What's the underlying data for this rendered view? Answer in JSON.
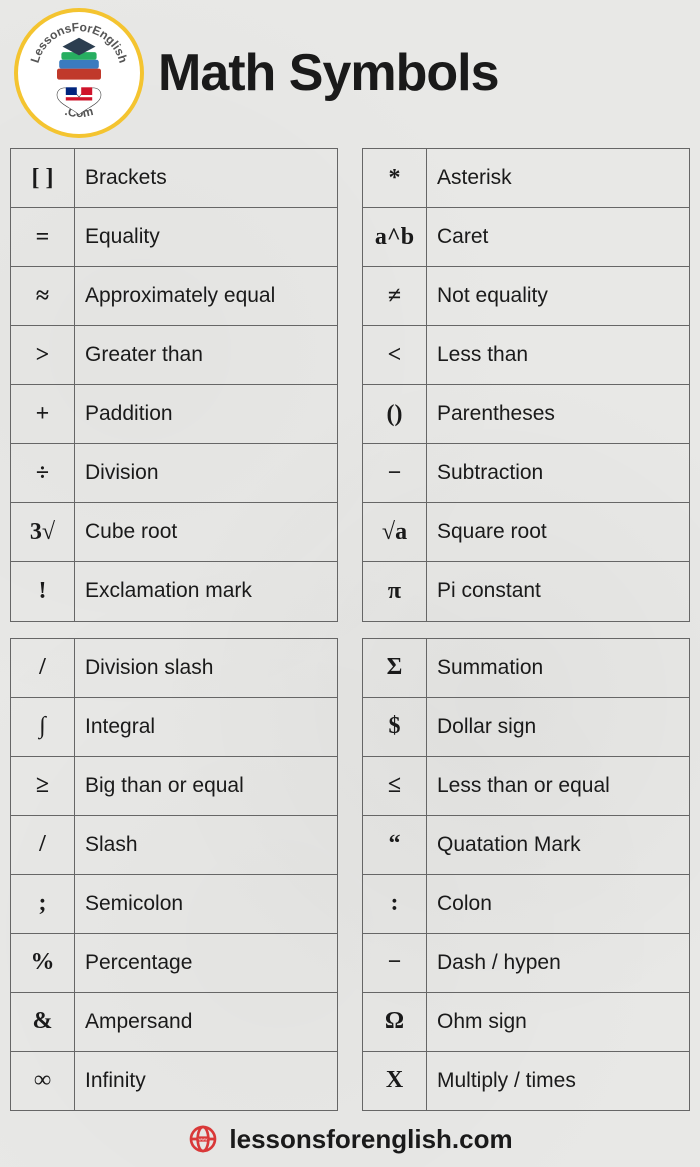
{
  "title": "Math Symbols",
  "logo_text": "LessonsForEnglish.Com",
  "footer": "lessonsforenglish.com",
  "tables": [
    [
      {
        "sym": "[ ]",
        "name": "Brackets"
      },
      {
        "sym": "=",
        "name": "Equality"
      },
      {
        "sym": "≈",
        "name": "Approximately equal"
      },
      {
        "sym": ">",
        "name": "Greater than"
      },
      {
        "sym": "+",
        "name": "Paddition"
      },
      {
        "sym": "÷",
        "name": "Division"
      },
      {
        "sym": "3√",
        "name": "Cube root"
      },
      {
        "sym": "!",
        "name": "Exclamation mark"
      }
    ],
    [
      {
        "sym": "*",
        "name": "Asterisk"
      },
      {
        "sym": "a^b",
        "name": "Caret"
      },
      {
        "sym": "≠",
        "name": "Not equality"
      },
      {
        "sym": "<",
        "name": "Less than"
      },
      {
        "sym": "()",
        "name": "Parentheses"
      },
      {
        "sym": "−",
        "name": "Subtraction"
      },
      {
        "sym": "√a",
        "name": "Square root"
      },
      {
        "sym": "π",
        "name": "Pi constant"
      }
    ],
    [
      {
        "sym": "/",
        "name": "Division slash"
      },
      {
        "sym": "∫",
        "name": "Integral"
      },
      {
        "sym": "≥",
        "name": "Big than or equal"
      },
      {
        "sym": "/",
        "name": "Slash"
      },
      {
        "sym": ";",
        "name": "Semicolon"
      },
      {
        "sym": "%",
        "name": "Percentage"
      },
      {
        "sym": "&",
        "name": "Ampersand"
      },
      {
        "sym": "∞",
        "name": "Infinity"
      }
    ],
    [
      {
        "sym": "Σ",
        "name": "Summation"
      },
      {
        "sym": "$",
        "name": "Dollar sign"
      },
      {
        "sym": "≤",
        "name": "Less than or equal"
      },
      {
        "sym": "“",
        "name": "Quatation Mark"
      },
      {
        "sym": ":",
        "name": "Colon"
      },
      {
        "sym": "−",
        "name": "Dash / hypen"
      },
      {
        "sym": "Ω",
        "name": "Ohm sign"
      },
      {
        "sym": "X",
        "name": "Multiply / times"
      }
    ]
  ]
}
